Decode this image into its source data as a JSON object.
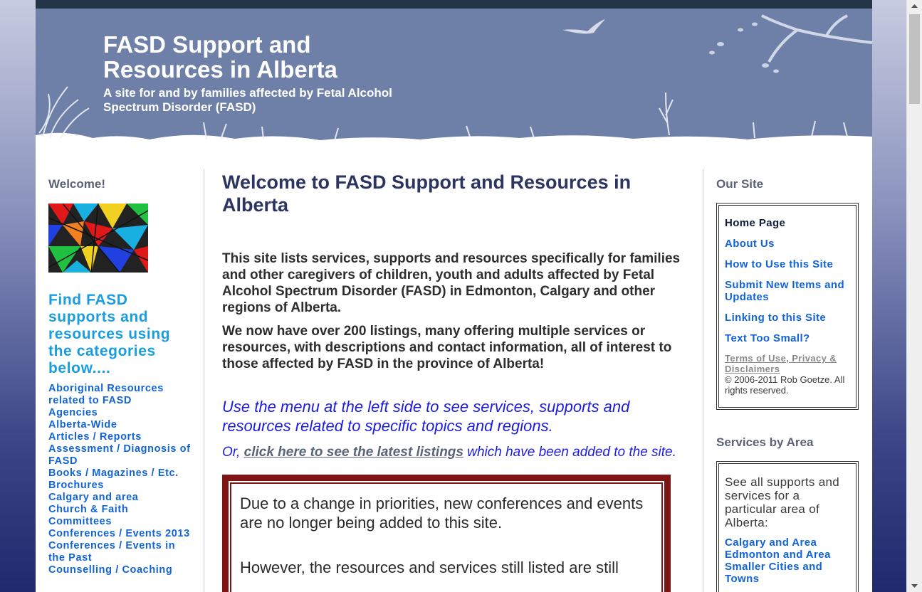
{
  "header": {
    "title": "FASD Support and Resources in Alberta",
    "tagline": "A site for and by families affected by Fetal Alcohol Spectrum Disorder (FASD)"
  },
  "left": {
    "welcome_heading": "Welcome!",
    "find_text": "Find FASD supports and resources using the categories below....",
    "categories": [
      "Aboriginal Resources related to FASD",
      "Agencies",
      "Alberta-Wide",
      "Articles / Reports",
      "Assessment / Diagnosis of FASD",
      "Books / Magazines / Etc.",
      "Brochures",
      "Calgary and area",
      "Church & Faith",
      "Committees",
      "Conferences / Events 2013",
      "Conferences / Events in the Past",
      "Counselling / Coaching"
    ]
  },
  "main": {
    "title": "Welcome to FASD Support and Resources in Alberta",
    "intro_1": "This site lists services, supports and resources specifically for families and other caregivers of children, youth and adults affected by Fetal Alcohol Spectrum Disorder (FASD) in Edmonton, Calgary and other regions of Alberta.",
    "intro_2": "We now have over 200 listings, many offering multiple services or resources, with descriptions and contact information, all of interest to those affected by FASD in the province of Alberta!",
    "menu_hint": "Use the menu at the left side to see services, supports and resources related to specific topics and regions.",
    "latest_prefix": "Or, ",
    "latest_link": "click here to see the latest listings",
    "latest_suffix": " which have been added to the site.",
    "notice_1": "Due to a change in priorities, new conferences and events are no longer being added to this site.",
    "notice_2": "However, the resources and services still listed are still"
  },
  "right": {
    "our_site_heading": "Our Site",
    "site_links": [
      "Home Page",
      "About Us",
      "How to Use this Site",
      "Submit New Items and Updates",
      "Linking to this Site",
      "Text Too Small?"
    ],
    "terms": "Terms of Use, Privacy & Disclaimers",
    "copyright": "© 2006-2011 Rob Goetze. All rights reserved.",
    "area_heading": "Services by Area",
    "area_desc": "See all supports and services for a particular area of Alberta:",
    "area_links": [
      "Calgary and Area",
      "Edmonton and Area",
      "Smaller Cities and Towns"
    ]
  }
}
